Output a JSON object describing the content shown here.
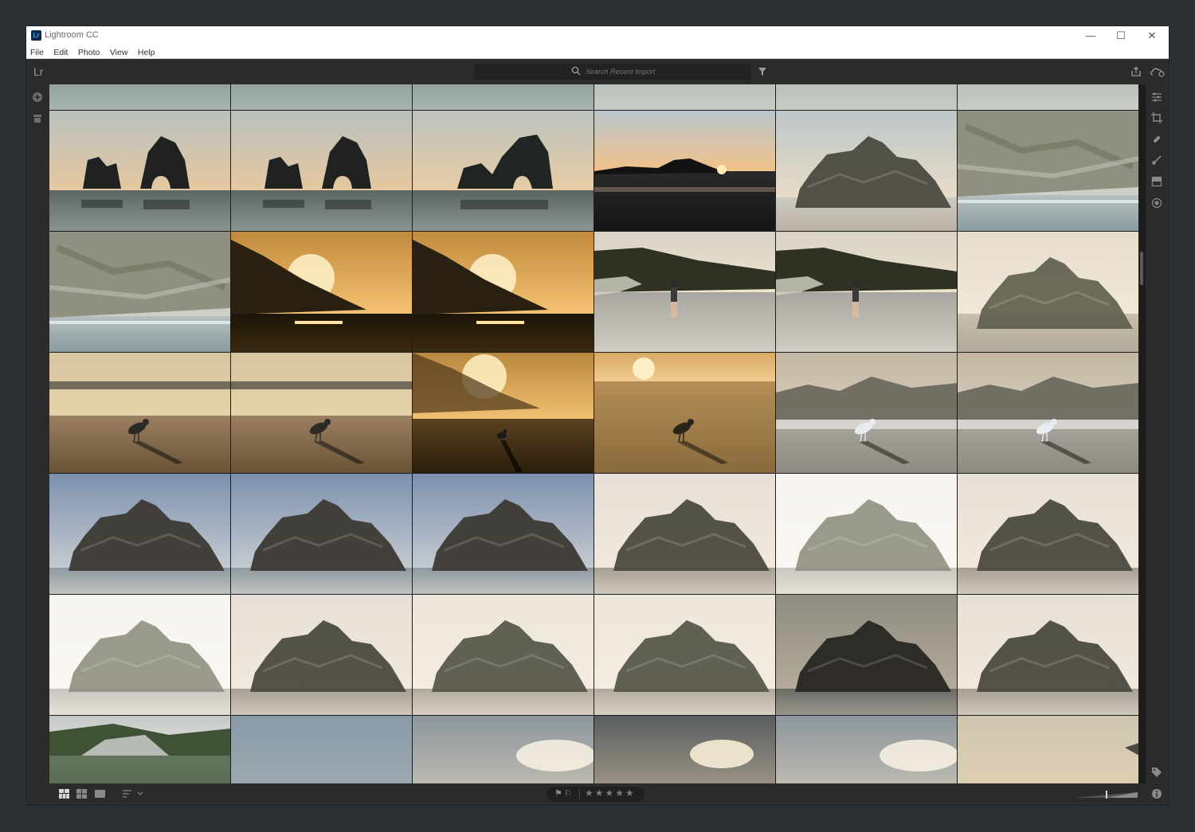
{
  "window": {
    "title": "Lightroom CC",
    "app_icon_text": "Lr",
    "controls": {
      "minimize": "—",
      "maximize": "☐",
      "close": "✕"
    }
  },
  "menu": [
    "File",
    "Edit",
    "Photo",
    "View",
    "Help"
  ],
  "toolbar": {
    "logo": "Lr",
    "search_placeholder": "Search Recent Import",
    "icons": [
      "search-icon",
      "filter-icon",
      "share-icon",
      "cloud-sync-icon"
    ]
  },
  "left_rail": {
    "icons": [
      "add-photos-icon",
      "library-icon"
    ]
  },
  "right_rail": {
    "icons": [
      "edit-sliders-icon",
      "crop-icon",
      "healing-icon",
      "brush-icon",
      "linear-gradient-icon",
      "radial-gradient-icon",
      "keyword-tag-icon",
      "info-icon"
    ]
  },
  "grid": {
    "columns": 6,
    "selected_index": 21,
    "rows": [
      [
        "arch-reflection-dark",
        "arch-reflection-dark",
        "arch-reflection-dark",
        "arch-reflection-light",
        "arch-reflection-light",
        "arch-reflection-light"
      ],
      [
        "arches-dusk",
        "arches-dusk",
        "arches-dusk-close",
        "headland-sunset",
        "rock-beach-day",
        "cliff-side"
      ],
      [
        "cliff-side",
        "sunburst-hill",
        "sunburst-hill",
        "person-beach",
        "person-beach",
        "rock-pale"
      ],
      [
        "gull-golden",
        "gull-golden",
        "gull-sunburst",
        "gull-amber",
        "gull-misty",
        "gull-misty"
      ],
      [
        "rock-blue-sky",
        "rock-blue-sky",
        "rock-blue-sky",
        "rock-warm",
        "rock-overexposed",
        "rock-warm"
      ],
      [
        "rock-overexposed",
        "rock-warm",
        "rock-warm-light",
        "rock-warm-light",
        "rock-dark",
        "rock-warm"
      ],
      [
        "dune-grass",
        "sky-plain",
        "sun-haze",
        "sun-haze-dark",
        "sun-haze",
        "beach-warm"
      ]
    ]
  },
  "bottombar": {
    "view_icons": [
      "square-grid-view-icon",
      "photo-grid-view-icon",
      "detail-view-icon"
    ],
    "sort_icon": "sort-icon",
    "flags": "⚑⚐",
    "stars": "★★★★★"
  },
  "colors": {
    "background": "#2b3035",
    "panel": "#2b2b2b",
    "grid_bg": "#1d1d1d",
    "selection": "#d8d8d8",
    "lr_blue": "#31a8ff"
  }
}
